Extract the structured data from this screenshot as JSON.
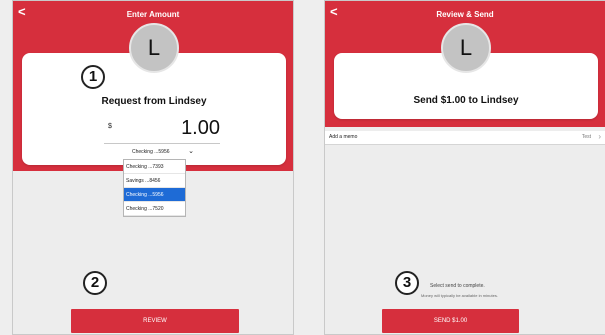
{
  "left_screen": {
    "back_glyph": "<",
    "title": "Enter Amount",
    "avatar_letter": "L",
    "step_number": "1",
    "request_title": "Request from Lindsey",
    "currency_symbol": "$",
    "amount": "1.00",
    "selected_account": "Checking ...5956",
    "account_options": [
      "Checking ...7393",
      "Savings ...8456",
      "Checking ...5956",
      "Checking ...7520"
    ],
    "selected_index": 2,
    "step2_number": "2",
    "review_button": "REVIEW"
  },
  "right_screen": {
    "back_glyph": "<",
    "title": "Review & Send",
    "avatar_letter": "L",
    "send_title": "Send $1.00 to Lindsey",
    "memo_label": "Add a memo",
    "memo_value": "Test",
    "step_number": "3",
    "instruction": "Select send to complete.",
    "sub_instruction": "Money will typically be available in minutes.",
    "send_button": "SEND $1.00"
  },
  "colors": {
    "brand_red": "#d62f3d",
    "selected_blue": "#1e6bd6"
  },
  "icons": [
    "back-chevron-icon",
    "dropdown-chevron-icon",
    "memo-chevron-icon"
  ]
}
